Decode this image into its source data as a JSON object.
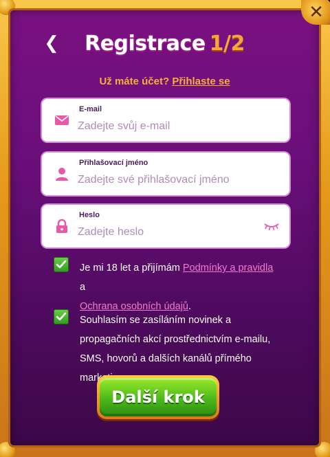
{
  "header": {
    "title_main": "Registrace",
    "title_step": "1/2",
    "back_icon": "chevron-left-icon",
    "close_icon": "close-icon"
  },
  "login_prompt": {
    "text": "Už máte účet?",
    "link": "Přihlaste se"
  },
  "fields": {
    "email": {
      "label": "E-mail",
      "placeholder": "Zadejte svůj e-mail",
      "icon": "envelope-icon"
    },
    "username": {
      "label": "Přihlašovací jméno",
      "placeholder": "Zadejte své přihlašovací jméno",
      "icon": "user-icon"
    },
    "password": {
      "label": "Heslo",
      "placeholder": "Zadejte heslo",
      "icon": "lock-icon",
      "toggle_icon": "eye-closed-icon"
    }
  },
  "consents": {
    "terms": {
      "checked": true,
      "text_before": "Je mi 18 let a přijímám ",
      "link1": "Podmínky a pravidla",
      "text_mid": " a",
      "link2": "Ochrana osobních údajů",
      "text_after": "."
    },
    "marketing": {
      "checked": true,
      "text": "Souhlasím se zasíláním novinek a propagačních akcí prostřednictvím e-mailu, SMS, hovorů a dalších kanálů přímého marketingu."
    }
  },
  "cta": {
    "label": "Další krok"
  },
  "colors": {
    "frame_gold": "#e69a1a",
    "panel_purple": "#6a0f7a",
    "accent_orange": "#f5b03a",
    "link_pink": "#f27ad0",
    "icon_pink": "#e85aa8",
    "cta_green": "#4bb81a"
  }
}
